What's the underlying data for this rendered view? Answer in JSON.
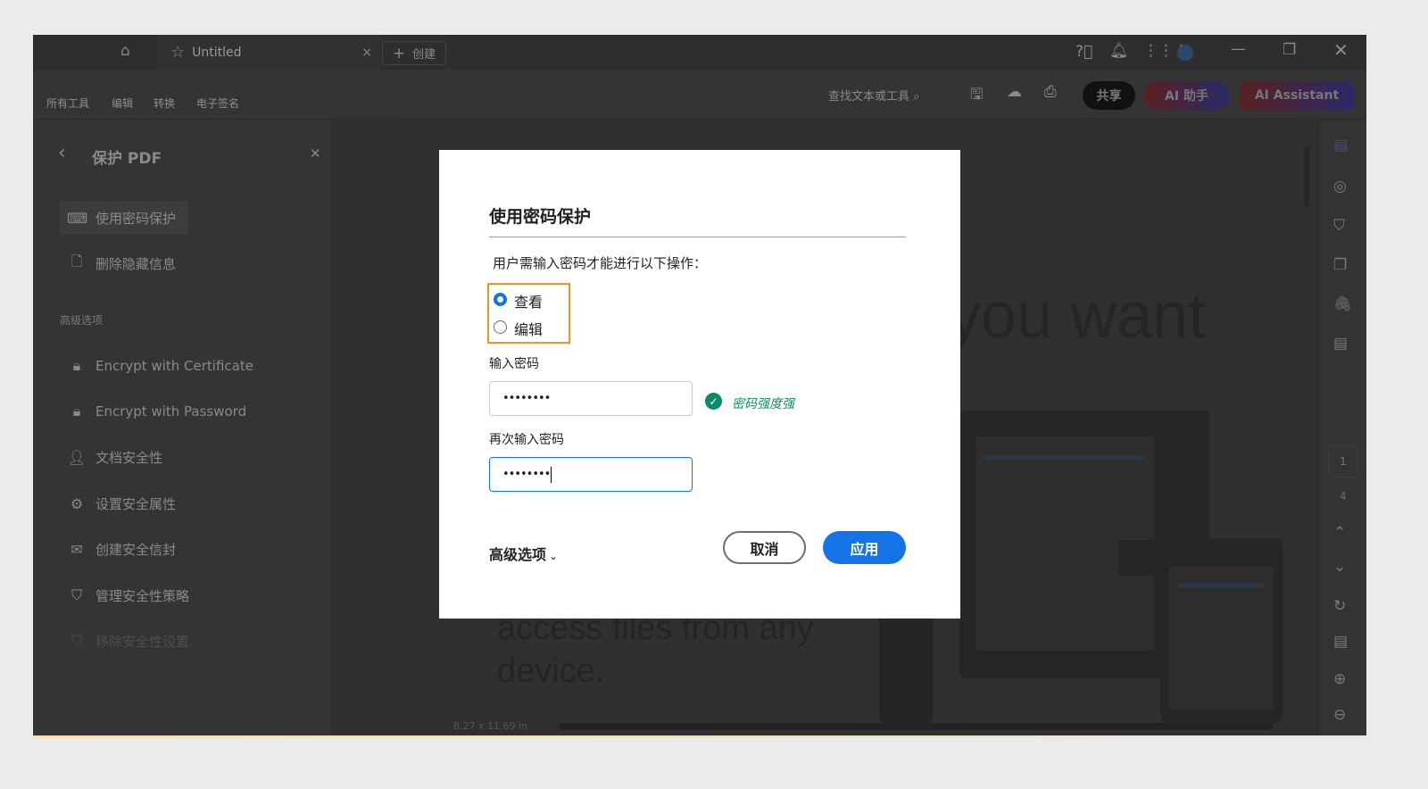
{
  "tabs": {
    "home_icon": "home-icon",
    "doc_tab": "Untitled",
    "create": "创建"
  },
  "menu": [
    "所有工具",
    "编辑",
    "转换",
    "电子签名"
  ],
  "toolbar": {
    "search": "查找文本或工具",
    "share": "共享",
    "ai_helper": "AI 助手",
    "ai_assistant": "AI Assistant"
  },
  "sidebar": {
    "title": "保护 PDF",
    "items": [
      "使用密码保护",
      "删除隐藏信息"
    ],
    "section": "高级选项",
    "advanced": [
      "Encrypt with Certificate",
      "Encrypt with Password",
      "文档安全性",
      "设置安全属性",
      "创建安全信封",
      "管理安全性策略",
      "移除安全性设置"
    ]
  },
  "doc": {
    "headline": "you want",
    "body_line1": "access files from any",
    "body_line2": "device.",
    "page_size": "8.27 x 11.69 in"
  },
  "rail": {
    "page_current": "1",
    "page_total": "4"
  },
  "dialog": {
    "title": "使用密码保护",
    "prompt": "用户需输入密码才能进行以下操作：",
    "options": [
      {
        "label": "查看",
        "selected": true
      },
      {
        "label": "编辑",
        "selected": false
      }
    ],
    "password_label": "输入密码",
    "password_value": "••••••••",
    "strength": "密码强度强",
    "confirm_label": "再次输入密码",
    "confirm_value": "••••••••",
    "advanced": "高级选项",
    "cancel": "取消",
    "apply": "应用"
  },
  "colors": {
    "accent": "#1473e6",
    "highlight": "#f29423",
    "strength": "#0c8a6b"
  }
}
